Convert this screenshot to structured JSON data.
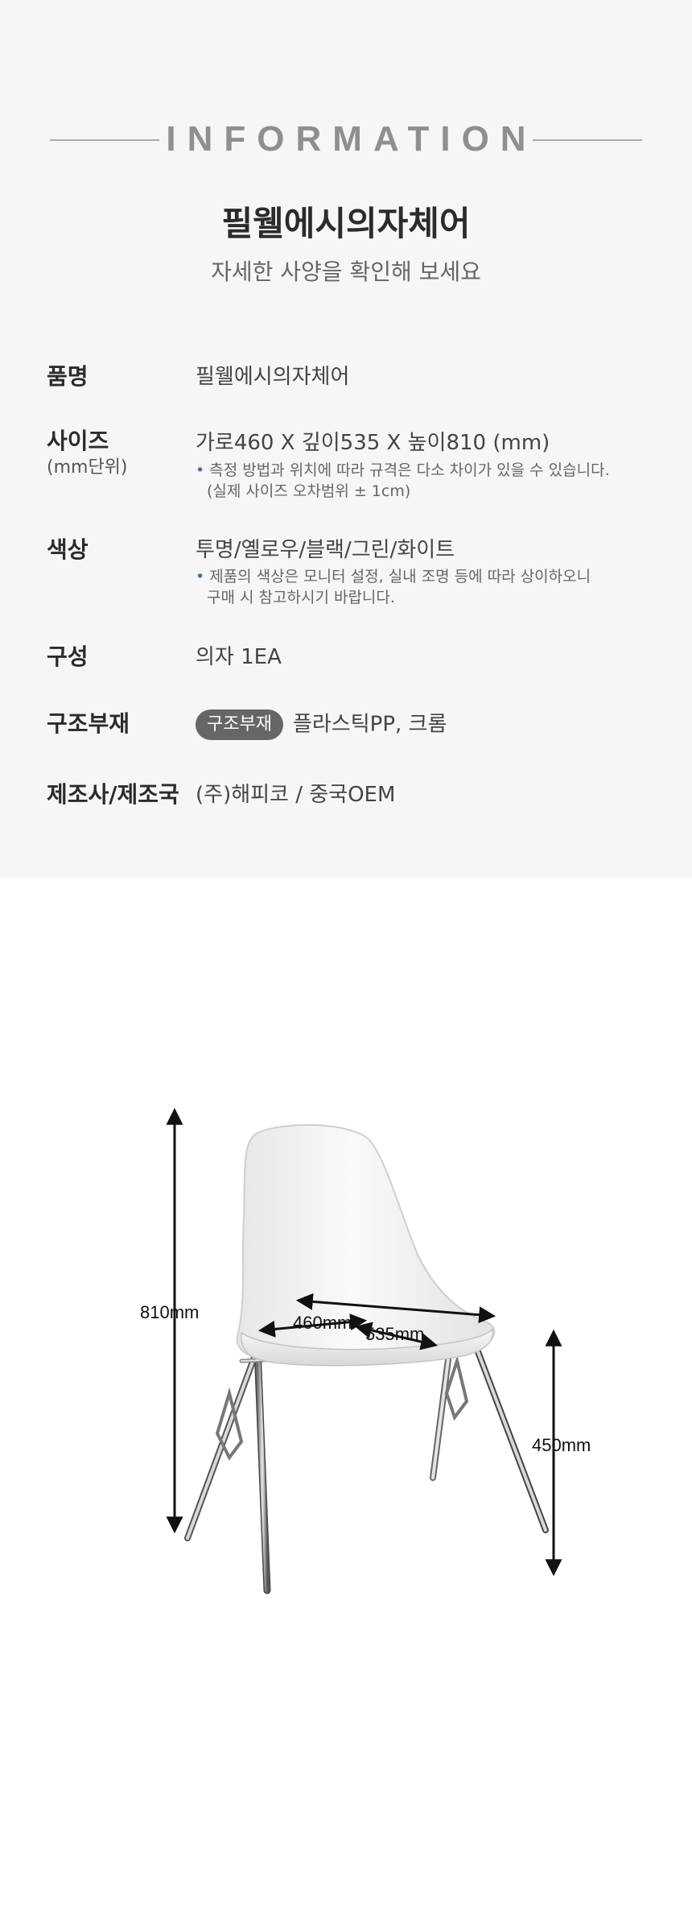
{
  "header": {
    "title": "INFORMATION",
    "product_name": "필웰에시의자체어",
    "subtitle": "자세한 사양을 확인해 보세요"
  },
  "specs": {
    "name": {
      "label": "품명",
      "value": "필웰에시의자체어"
    },
    "size": {
      "label": "사이즈",
      "sublabel": "(mm단위)",
      "value": "가로460 X 깊이535 X 높이810 (mm)",
      "note_line1": "측정 방법과 위치에 따라 규격은 다소 차이가 있을 수 있습니다.",
      "note_line2": "(실제 사이즈 오차범위 ± 1cm)"
    },
    "color": {
      "label": "색상",
      "value": "투명/옐로우/블랙/그린/화이트",
      "note_line1": "제품의 색상은 모니터 설정, 실내 조명 등에 따라 상이하오니",
      "note_line2": "구매 시 참고하시기 바랍니다."
    },
    "composition": {
      "label": "구성",
      "value": "의자 1EA"
    },
    "material": {
      "label": "구조부재",
      "tag": "구조부재",
      "value": "플라스틱PP, 크롬"
    },
    "manufacturer": {
      "label": "제조사/제조국",
      "value": "(주)해피코 / 중국OEM"
    }
  },
  "dimensions": {
    "height": "810mm",
    "width": "460mm",
    "depth": "535mm",
    "seat_height": "450mm"
  },
  "colors": {
    "bullet": "#4a6fa5",
    "tag_bg": "#666666",
    "section_bg": "#f6f6f6"
  }
}
